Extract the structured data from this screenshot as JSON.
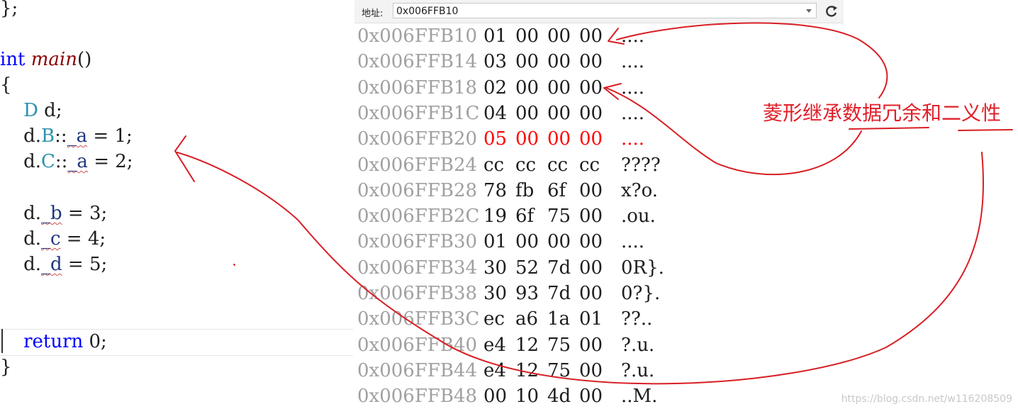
{
  "code_lines": [
    {
      "tokens": [
        {
          "text": "};",
          "cls": ""
        }
      ]
    },
    {
      "tokens": [
        {
          "text": "int",
          "cls": "kw"
        },
        {
          "text": " ",
          "cls": ""
        },
        {
          "text": "main",
          "cls": "fn"
        },
        {
          "text": "()",
          "cls": ""
        }
      ]
    },
    {
      "tokens": [
        {
          "text": "{",
          "cls": ""
        }
      ]
    },
    {
      "tokens": [
        {
          "text": "    ",
          "cls": ""
        },
        {
          "text": "D",
          "cls": "ty"
        },
        {
          "text": " d;",
          "cls": ""
        }
      ]
    },
    {
      "tokens": [
        {
          "text": "    ",
          "cls": ""
        },
        {
          "text": "d.",
          "cls": ""
        },
        {
          "text": "B",
          "cls": "ty"
        },
        {
          "text": "::",
          "cls": ""
        },
        {
          "text": "_a",
          "cls": "var sq"
        },
        {
          "text": " = 1;",
          "cls": ""
        }
      ]
    },
    {
      "tokens": [
        {
          "text": "    ",
          "cls": ""
        },
        {
          "text": "d.",
          "cls": ""
        },
        {
          "text": "C",
          "cls": "ty"
        },
        {
          "text": "::",
          "cls": ""
        },
        {
          "text": "_a",
          "cls": "var sq"
        },
        {
          "text": " = 2;",
          "cls": ""
        }
      ]
    },
    {
      "tokens": [
        {
          "text": "    ",
          "cls": ""
        },
        {
          "text": "d.",
          "cls": ""
        },
        {
          "text": "_b",
          "cls": "var sq"
        },
        {
          "text": " = 3;",
          "cls": ""
        }
      ]
    },
    {
      "tokens": [
        {
          "text": "    ",
          "cls": ""
        },
        {
          "text": "d.",
          "cls": ""
        },
        {
          "text": "_c",
          "cls": "var sq"
        },
        {
          "text": " = 4;",
          "cls": ""
        }
      ]
    },
    {
      "tokens": [
        {
          "text": "    ",
          "cls": ""
        },
        {
          "text": "d.",
          "cls": ""
        },
        {
          "text": "_d",
          "cls": "var sq"
        },
        {
          "text": " = 5;",
          "cls": ""
        }
      ]
    },
    {
      "tokens": [
        {
          "text": "    ",
          "cls": ""
        },
        {
          "text": "return",
          "cls": "kw"
        },
        {
          "text": " 0;",
          "cls": ""
        }
      ]
    },
    {
      "tokens": [
        {
          "text": "}",
          "cls": ""
        }
      ]
    }
  ],
  "memory": {
    "address_label": "地址:",
    "address_value": "0x006FFB10",
    "rows": [
      {
        "addr": "0x006FFB10",
        "bytes": [
          "01",
          "00",
          "00",
          "00"
        ],
        "text": "....",
        "highlight": false
      },
      {
        "addr": "0x006FFB14",
        "bytes": [
          "03",
          "00",
          "00",
          "00"
        ],
        "text": "....",
        "highlight": false
      },
      {
        "addr": "0x006FFB18",
        "bytes": [
          "02",
          "00",
          "00",
          "00"
        ],
        "text": "....",
        "highlight": false
      },
      {
        "addr": "0x006FFB1C",
        "bytes": [
          "04",
          "00",
          "00",
          "00"
        ],
        "text": "....",
        "highlight": false
      },
      {
        "addr": "0x006FFB20",
        "bytes": [
          "05",
          "00",
          "00",
          "00"
        ],
        "text": "....",
        "highlight": true
      },
      {
        "addr": "0x006FFB24",
        "bytes": [
          "cc",
          "cc",
          "cc",
          "cc"
        ],
        "text": "????",
        "highlight": false
      },
      {
        "addr": "0x006FFB28",
        "bytes": [
          "78",
          "fb",
          "6f",
          "00"
        ],
        "text": "x?o.",
        "highlight": false
      },
      {
        "addr": "0x006FFB2C",
        "bytes": [
          "19",
          "6f",
          "75",
          "00"
        ],
        "text": ".ou.",
        "highlight": false
      },
      {
        "addr": "0x006FFB30",
        "bytes": [
          "01",
          "00",
          "00",
          "00"
        ],
        "text": "....",
        "highlight": false
      },
      {
        "addr": "0x006FFB34",
        "bytes": [
          "30",
          "52",
          "7d",
          "00"
        ],
        "text": "0R}.",
        "highlight": false
      },
      {
        "addr": "0x006FFB38",
        "bytes": [
          "30",
          "93",
          "7d",
          "00"
        ],
        "text": "0?}.",
        "highlight": false
      },
      {
        "addr": "0x006FFB3C",
        "bytes": [
          "ec",
          "a6",
          "1a",
          "01"
        ],
        "text": "??..",
        "highlight": false
      },
      {
        "addr": "0x006FFB40",
        "bytes": [
          "e4",
          "12",
          "75",
          "00"
        ],
        "text": "?.u.",
        "highlight": false
      },
      {
        "addr": "0x006FFB44",
        "bytes": [
          "e4",
          "12",
          "75",
          "00"
        ],
        "text": "?.u.",
        "highlight": false
      },
      {
        "addr": "0x006FFB48",
        "bytes": [
          "00",
          "10",
          "4d",
          "00"
        ],
        "text": "..M.",
        "highlight": false
      }
    ]
  },
  "annotation": {
    "text": "菱形继承数据冗余和二义性",
    "color": "#e0202a"
  },
  "watermark": "https://blog.csdn.net/w116208509",
  "icons": {
    "refresh": "refresh-icon",
    "dropdown": "chevron-down-icon"
  }
}
